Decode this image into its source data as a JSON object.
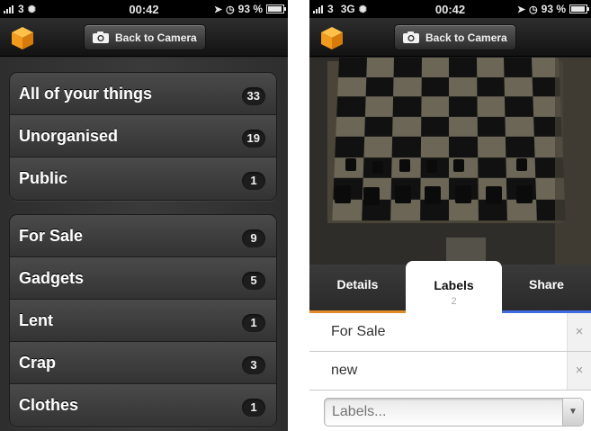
{
  "left_screen": {
    "status_bar": {
      "carrier": "3",
      "time": "00:42",
      "battery": "93 %",
      "battery_level": 0.93
    },
    "nav": {
      "back_label": "Back to Camera",
      "logo_icon": "cube-logo-icon",
      "camera_icon": "camera-icon"
    },
    "group1": [
      {
        "label": "All of your things",
        "count": "33"
      },
      {
        "label": "Unorganised",
        "count": "19"
      },
      {
        "label": "Public",
        "count": "1"
      }
    ],
    "group2": [
      {
        "label": "For Sale",
        "count": "9"
      },
      {
        "label": "Gadgets",
        "count": "5"
      },
      {
        "label": "Lent",
        "count": "1"
      },
      {
        "label": "Crap",
        "count": "3"
      },
      {
        "label": "Clothes",
        "count": "1"
      }
    ]
  },
  "right_screen": {
    "status_bar": {
      "carrier": "3",
      "network": "3G",
      "time": "00:42",
      "battery": "93 %",
      "battery_level": 0.93
    },
    "nav": {
      "back_label": "Back to Camera"
    },
    "tabs": {
      "details": "Details",
      "labels": "Labels",
      "labels_count": "2",
      "share": "Share"
    },
    "labels": [
      "For Sale",
      "new"
    ],
    "remove_glyph": "×",
    "label_input": {
      "placeholder": "Labels...",
      "value": ""
    },
    "dropdown_glyph": "▼"
  },
  "colors": {
    "details_tab_accent": "#e08b2a",
    "share_tab_accent": "#3f6ae0",
    "logo_orange": "#f29a1d"
  }
}
